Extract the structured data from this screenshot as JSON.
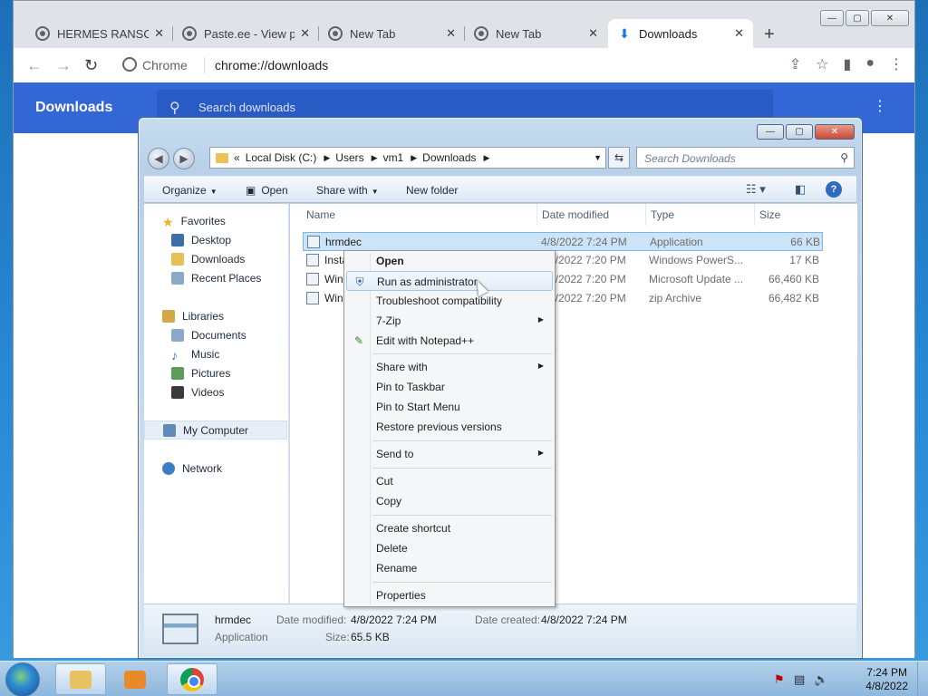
{
  "chrome": {
    "tabs": [
      {
        "label": "HERMES RANSOM",
        "icon": "globe-icon"
      },
      {
        "label": "Paste.ee - View paste",
        "icon": "globe-icon"
      },
      {
        "label": "New Tab",
        "icon": "chrome-icon"
      },
      {
        "label": "New Tab",
        "icon": "chrome-icon"
      },
      {
        "label": "Downloads",
        "icon": "download-icon"
      }
    ],
    "new_tab_label": "+",
    "site_chip": "Chrome",
    "url": "chrome://downloads",
    "page_title": "Downloads",
    "search_placeholder": "Search downloads"
  },
  "explorer": {
    "breadcrumb": [
      "Local Disk (C:)",
      "Users",
      "vm1",
      "Downloads"
    ],
    "breadcrumb_prefix": "«",
    "search_placeholder": "Search Downloads",
    "commands": {
      "organize": "Organize",
      "open": "Open",
      "share_with": "Share with",
      "new_folder": "New folder"
    },
    "nav": {
      "favorites": "Favorites",
      "desktop": "Desktop",
      "downloads": "Downloads",
      "recent_places": "Recent Places",
      "libraries": "Libraries",
      "documents": "Documents",
      "music": "Music",
      "pictures": "Pictures",
      "videos": "Videos",
      "my_computer": "My Computer",
      "network": "Network"
    },
    "columns": {
      "name": "Name",
      "date": "Date modified",
      "type": "Type",
      "size": "Size"
    },
    "files": [
      {
        "name": "hrmdec",
        "date": "4/8/2022 7:24 PM",
        "type": "Application",
        "size": "66 KB"
      },
      {
        "name": "Insta",
        "date": "4/8/2022 7:20 PM",
        "type": "Windows PowerS...",
        "size": "17 KB"
      },
      {
        "name": "Win",
        "date": "4/8/2022 7:20 PM",
        "type": "Microsoft Update ...",
        "size": "66,460 KB"
      },
      {
        "name": "Win",
        "date": "4/8/2022 7:20 PM",
        "type": "zip Archive",
        "size": "66,482 KB"
      }
    ],
    "details": {
      "name": "hrmdec",
      "type": "Application",
      "date_modified_label": "Date modified:",
      "date_modified": "4/8/2022 7:24 PM",
      "date_created_label": "Date created:",
      "date_created": "4/8/2022 7:24 PM",
      "size_label": "Size:",
      "size": "65.5 KB"
    }
  },
  "context_menu": {
    "open": "Open",
    "run_as_admin": "Run as administrator",
    "troubleshoot": "Troubleshoot compatibility",
    "seven_zip": "7-Zip",
    "edit_notepad": "Edit with Notepad++",
    "share_with": "Share with",
    "pin_taskbar": "Pin to Taskbar",
    "pin_start": "Pin to Start Menu",
    "restore_versions": "Restore previous versions",
    "send_to": "Send to",
    "cut": "Cut",
    "copy": "Copy",
    "create_shortcut": "Create shortcut",
    "delete": "Delete",
    "rename": "Rename",
    "properties": "Properties"
  },
  "taskbar": {
    "time": "7:24 PM",
    "date": "4/8/2022"
  },
  "colors": {
    "chrome_accent": "#3367d6",
    "selection": "#cce4f7"
  }
}
